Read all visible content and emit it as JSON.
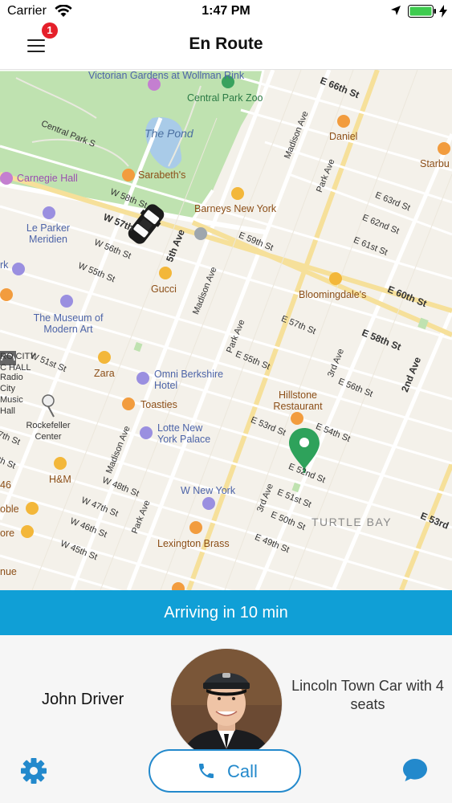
{
  "status_bar": {
    "carrier": "Carrier",
    "time": "1:47 PM",
    "icons": [
      "wifi-icon",
      "location-arrow-icon",
      "battery-icon",
      "charging-bolt-icon"
    ]
  },
  "nav": {
    "title": "En Route",
    "badge_count": "1",
    "menu_icon": "hamburger-menu-icon"
  },
  "map": {
    "pois": [
      {
        "name": "Victorian Gardens at Wollman Rink"
      },
      {
        "name": "Central Park Zoo"
      },
      {
        "name": "The Pond"
      },
      {
        "name": "Carnegie Hall"
      },
      {
        "name": "Sarabeth's"
      },
      {
        "name": "Barneys New York"
      },
      {
        "name": "Le Parker Meridien"
      },
      {
        "name": "Gucci"
      },
      {
        "name": "Bloomingdale's"
      },
      {
        "name": "The Museum of Modern Art"
      },
      {
        "name": "Zara"
      },
      {
        "name": "Omni Berkshire Hotel"
      },
      {
        "name": "Toasties"
      },
      {
        "name": "Lotte New York Palace"
      },
      {
        "name": "Hillstone Restaurant"
      },
      {
        "name": "Rockefeller Center"
      },
      {
        "name": "H&M"
      },
      {
        "name": "W New York"
      },
      {
        "name": "Lexington Brass"
      },
      {
        "name": "Daniel"
      },
      {
        "name": "Starbu"
      },
      {
        "name": "Radio City Music Hall"
      }
    ],
    "streets": [
      "E 66th St",
      "Central Park S",
      "W 58th St",
      "W 57th",
      "W 56th St",
      "W 55th St",
      "W 51st St",
      "W 48th St",
      "W 47th St",
      "W 46th St",
      "W 45th St",
      "E 59th St",
      "E 58th St",
      "E 57th St",
      "E 56th St",
      "E 55th St",
      "E 54th St",
      "E 53rd St",
      "E 52nd St",
      "E 51st St",
      "E 50th St",
      "E 49th St",
      "E 63rd St",
      "E 62nd St",
      "E 61st St",
      "E 60th St",
      "E 53rd",
      "5th Ave",
      "Madison Ave",
      "Park Ave",
      "3rd Ave",
      "2nd Ave"
    ],
    "neighborhood": "TURTLE BAY",
    "edge_labels": [
      "RO CITY",
      "C HALL",
      "46",
      "oble",
      "ore",
      "nue",
      "rk",
      "7th St",
      "th St"
    ]
  },
  "trip": {
    "arriving_text": "Arriving in 10 min"
  },
  "driver": {
    "name": "John Driver",
    "car_description": "Lincoln Town Car with 4 seats",
    "call_label": "Call"
  },
  "colors": {
    "accent": "#109fd6",
    "call_blue": "#2389cc",
    "badge_red": "#e5202a",
    "pin_green": "#2ea25b",
    "park_green": "#bfe2b0"
  }
}
